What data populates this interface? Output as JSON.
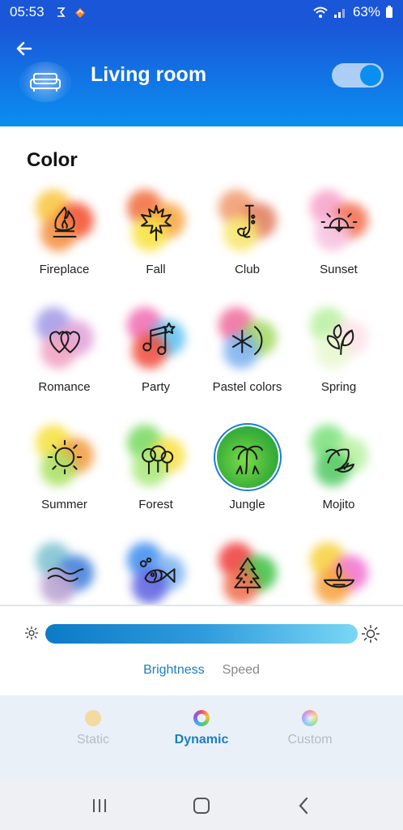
{
  "status_bar": {
    "time": "05:53",
    "battery": "63%"
  },
  "header": {
    "room_name": "Living room",
    "toggle_on": true
  },
  "section": {
    "title": "Color"
  },
  "scenes": [
    {
      "label": "Fireplace",
      "icon": "fireplace-icon",
      "colors": [
        "#f7c43a",
        "#f24b2a",
        "#f58b3a"
      ]
    },
    {
      "label": "Fall",
      "icon": "maple-leaf-icon",
      "colors": [
        "#f06a3a",
        "#f7a23a",
        "#f7e23a"
      ]
    },
    {
      "label": "Club",
      "icon": "saxophone-icon",
      "colors": [
        "#f0986a",
        "#e07a5a",
        "#f7e66a"
      ]
    },
    {
      "label": "Sunset",
      "icon": "sunset-icon",
      "colors": [
        "#f7a0c8",
        "#f26a4a",
        "#f7c0e0"
      ]
    },
    {
      "label": "Romance",
      "icon": "hearts-icon",
      "colors": [
        "#a098e8",
        "#e0a0d8",
        "#f0a0c0"
      ]
    },
    {
      "label": "Party",
      "icon": "music-notes-icon",
      "colors": [
        "#f06ab0",
        "#5ac0f0",
        "#f04a3a"
      ]
    },
    {
      "label": "Pastel colors",
      "icon": "pastel-icon",
      "colors": [
        "#f06a9a",
        "#a0d860",
        "#7ab0f0"
      ]
    },
    {
      "label": "Spring",
      "icon": "leaves-icon",
      "colors": [
        "#b8f0a0",
        "#fce0e8",
        "#e8f8d0"
      ]
    },
    {
      "label": "Summer",
      "icon": "sun-icon",
      "colors": [
        "#f7e03a",
        "#f09a3a",
        "#a8e060"
      ]
    },
    {
      "label": "Forest",
      "icon": "trees-icon",
      "colors": [
        "#78d860",
        "#f7e040",
        "#a8e878"
      ]
    },
    {
      "label": "Jungle",
      "icon": "palm-tree-icon",
      "colors": [
        "#5ac040",
        "#f7e040",
        "#3aa040"
      ]
    },
    {
      "label": "Mojito",
      "icon": "lime-icon",
      "colors": [
        "#7ae07a",
        "#b8f0a0",
        "#50c860"
      ]
    },
    {
      "label": "",
      "icon": "waves-icon",
      "colors": [
        "#7ac0d0",
        "#3a7ad8",
        "#b8a0d0"
      ]
    },
    {
      "label": "",
      "icon": "fish-icon",
      "colors": [
        "#3a8af0",
        "#7ab0f0",
        "#5a60e0"
      ]
    },
    {
      "label": "",
      "icon": "christmas-tree-icon",
      "colors": [
        "#f03a3a",
        "#3ac040",
        "#f06a4a"
      ]
    },
    {
      "label": "",
      "icon": "diya-lamp-icon",
      "colors": [
        "#f7d03a",
        "#f070d0",
        "#f7a03a"
      ]
    }
  ],
  "selected_scene": "Jungle",
  "slider": {
    "brightness_fraction": 1.0,
    "tabs": [
      {
        "label": "Brightness",
        "active": true
      },
      {
        "label": "Speed",
        "active": false
      }
    ]
  },
  "modes": [
    {
      "label": "Static",
      "active": false,
      "dot": "#f1dba0"
    },
    {
      "label": "Dynamic",
      "active": true,
      "dot": "conic"
    },
    {
      "label": "Custom",
      "active": false,
      "dot": "conic-faded"
    }
  ],
  "colors": {
    "header_top": "#1a56d8",
    "header_bottom": "#0a8ff0",
    "accent": "#1a7fc0"
  }
}
